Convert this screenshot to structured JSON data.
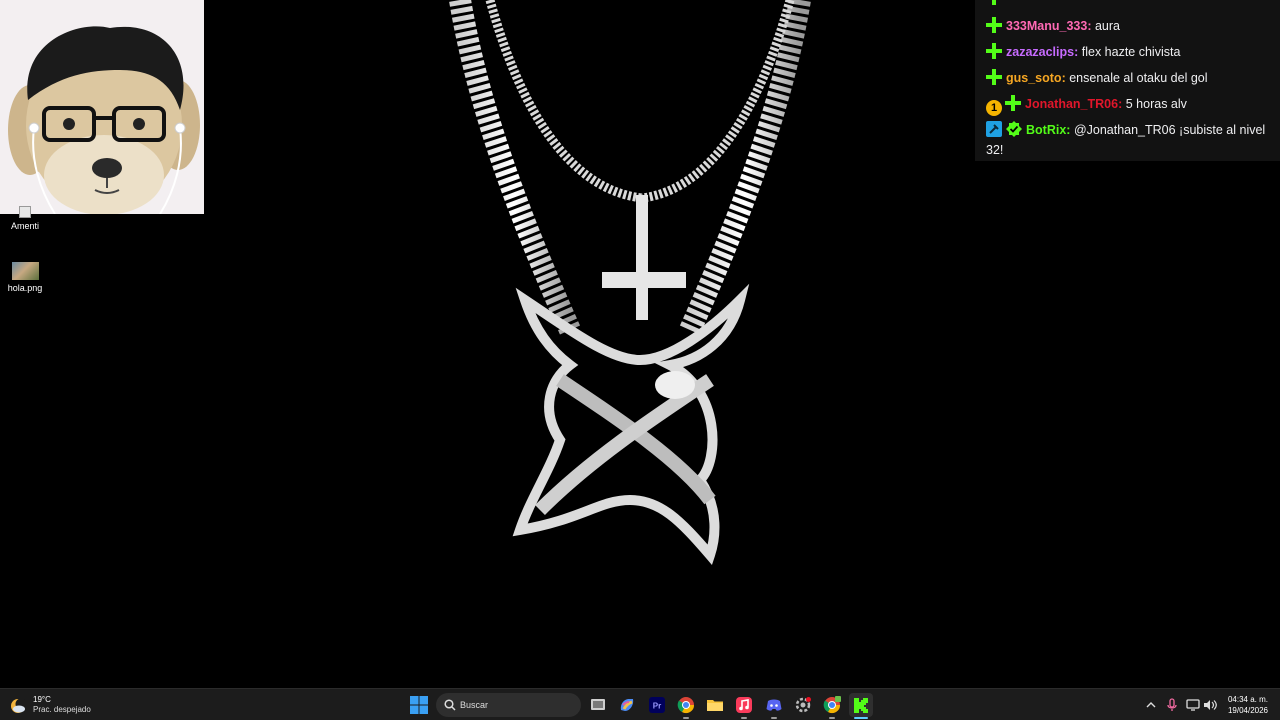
{
  "desktop": {
    "icons": [
      {
        "label": "Amenti",
        "icon": "shortcut-file-icon"
      },
      {
        "label": "hola.png",
        "icon": "image-file-icon"
      }
    ],
    "wallpaper": {
      "description_icon": "chain-pendant-icon"
    }
  },
  "webcam": {
    "icon": "dog-with-glasses-icon"
  },
  "chat": {
    "messages": [
      {
        "user": "333Manu_333",
        "text": "aura",
        "user_color": "#ff69b4",
        "badges": [
          "kick-sub-badge"
        ]
      },
      {
        "user": "zazazaclips",
        "text": "flex hazte chivista",
        "user_color": "#c76bff",
        "badges": [
          "kick-sub-badge"
        ]
      },
      {
        "user": "gus_soto",
        "text": "ensenale al otaku del gol",
        "user_color": "#f5a623",
        "badges": [
          "kick-sub-badge"
        ]
      },
      {
        "user": "Jonathan_TR06",
        "text": "5 horas alv",
        "user_color": "#e0162b",
        "badges": [
          "gifter-badge",
          "kick-sub-badge"
        ],
        "gifter_label": "1"
      },
      {
        "user": "BotRix",
        "text": "@Jonathan_TR06 ¡subiste al nivel 32!",
        "user_color": "#53fc18",
        "badges": [
          "bot-badge",
          "verified-badge"
        ]
      }
    ],
    "colors": {
      "kick_green": "#53fc18",
      "gifter_gold": "#f5b400",
      "bot_blue": "#1fa1e3"
    }
  },
  "taskbar": {
    "weather": {
      "temp": "19°C",
      "condition": "Prac. despejado"
    },
    "search_placeholder": "Buscar",
    "apps": [
      {
        "name": "start-button"
      },
      {
        "name": "task-view-button"
      },
      {
        "name": "copilot-app"
      },
      {
        "name": "premiere-pro-app",
        "label": "Pr"
      },
      {
        "name": "chrome-app"
      },
      {
        "name": "file-explorer-app"
      },
      {
        "name": "itunes-app"
      },
      {
        "name": "discord-app"
      },
      {
        "name": "settings-app"
      },
      {
        "name": "chrome-profile-app"
      },
      {
        "name": "kick-app"
      }
    ],
    "clock": {
      "time": "04:34 a. m.",
      "date": "19/04/2026"
    }
  }
}
